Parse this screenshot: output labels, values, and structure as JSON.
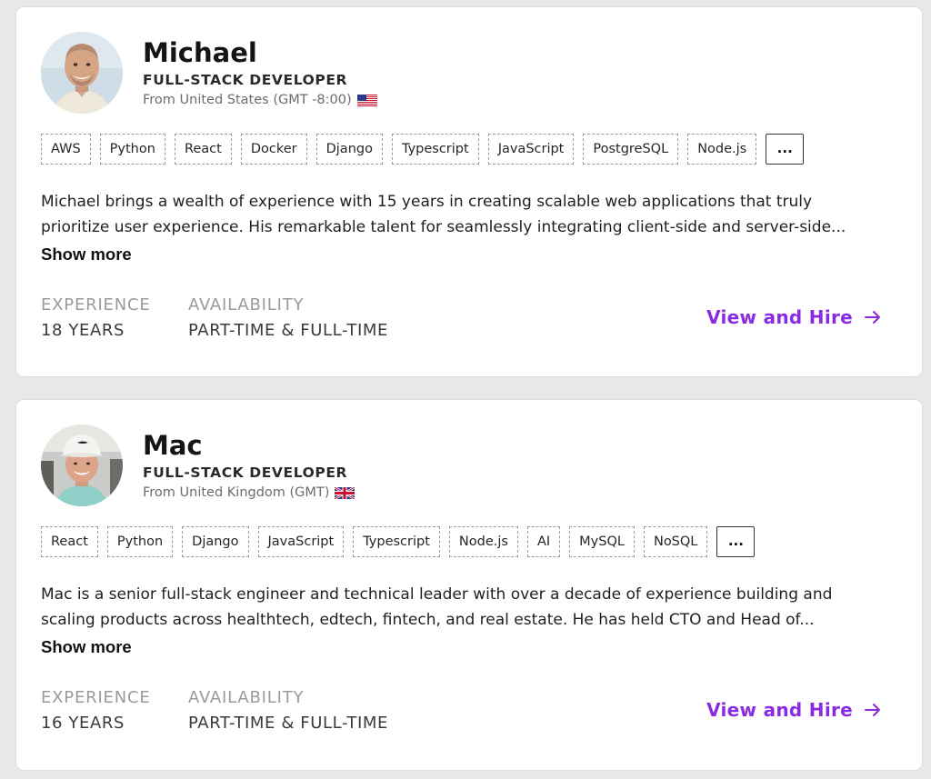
{
  "theme": {
    "accent": "#8a2be2",
    "tag_border": "#9b9b9b",
    "label_gray": "#9a9a9a"
  },
  "candidates": [
    {
      "name": "Michael",
      "role": "FULL-STACK DEVELOPER",
      "location": "From United States (GMT -8:00)",
      "flag_icon": "us-flag-icon",
      "skills": [
        "AWS",
        "Python",
        "React",
        "Docker",
        "Django",
        "Typescript",
        "JavaScript",
        "PostgreSQL",
        "Node.js"
      ],
      "more_label": "...",
      "description_lines": [
        "Michael brings a wealth of experience with 15 years in creating scalable web applications that truly",
        "prioritize user experience. His remarkable talent for seamlessly integrating client-side and server-side..."
      ],
      "show_more": "Show more",
      "experience_label": "EXPERIENCE",
      "experience_value": "18 YEARS",
      "availability_label": "AVAILABILITY",
      "availability_value": "PART-TIME & FULL-TIME",
      "cta": "View and Hire"
    },
    {
      "name": "Mac",
      "role": "FULL-STACK DEVELOPER",
      "location": "From United Kingdom (GMT)",
      "flag_icon": "uk-flag-icon",
      "skills": [
        "React",
        "Python",
        "Django",
        "JavaScript",
        "Typescript",
        "Node.js",
        "AI",
        "MySQL",
        "NoSQL"
      ],
      "more_label": "...",
      "description_lines": [
        "Mac is a senior full-stack engineer and technical leader with over a decade of experience building and",
        "scaling products across healthtech, edtech, fintech, and real estate. He has held CTO and Head of..."
      ],
      "show_more": "Show more",
      "experience_label": "EXPERIENCE",
      "experience_value": "16 YEARS",
      "availability_label": "AVAILABILITY",
      "availability_value": "PART-TIME & FULL-TIME",
      "cta": "View and Hire"
    }
  ]
}
